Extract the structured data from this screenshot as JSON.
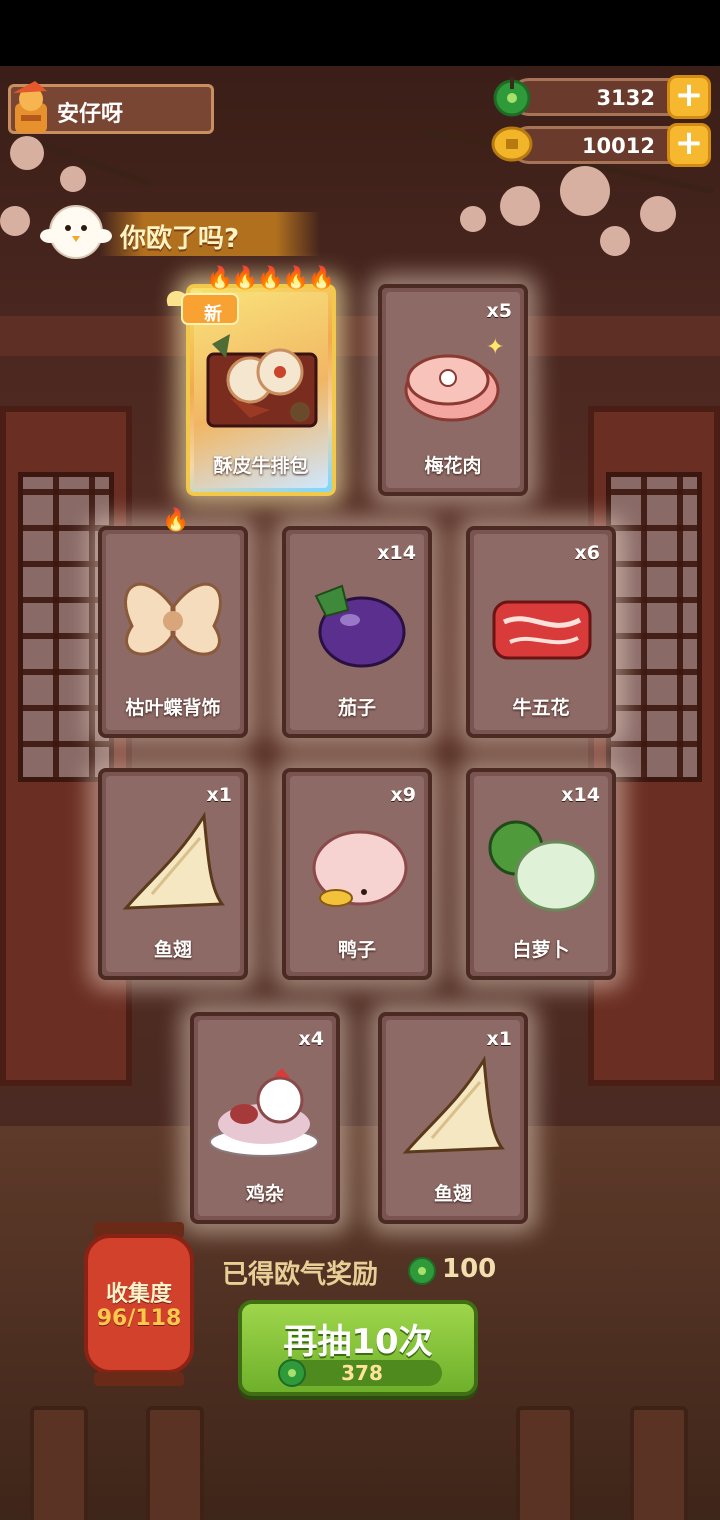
{
  "player": {
    "name": "安仔呀"
  },
  "currencies": [
    {
      "icon": "jade-icon",
      "value": "3132"
    },
    {
      "icon": "coin-icon",
      "value": "10012"
    }
  ],
  "banner": {
    "text": "你欧了吗?"
  },
  "new_tag": "新",
  "cards": [
    {
      "name": "酥皮牛排包",
      "qty": "",
      "rarity": "gold",
      "is_new": true,
      "flames": 5
    },
    {
      "name": "梅花肉",
      "qty": "x5",
      "rarity": "normal"
    },
    {
      "name": "枯叶蝶背饰",
      "qty": "",
      "rarity": "normal",
      "flames": 1
    },
    {
      "name": "茄子",
      "qty": "x14",
      "rarity": "normal"
    },
    {
      "name": "牛五花",
      "qty": "x6",
      "rarity": "normal"
    },
    {
      "name": "鱼翅",
      "qty": "x1",
      "rarity": "normal"
    },
    {
      "name": "鸭子",
      "qty": "x9",
      "rarity": "normal"
    },
    {
      "name": "白萝卜",
      "qty": "x14",
      "rarity": "normal"
    },
    {
      "name": "鸡杂",
      "qty": "x4",
      "rarity": "normal"
    },
    {
      "name": "鱼翅",
      "qty": "x1",
      "rarity": "normal"
    }
  ],
  "collection": {
    "label": "收集度",
    "progress": "96/118"
  },
  "reward": {
    "label": "已得欧气奖励",
    "value": "100"
  },
  "draw_button": {
    "label": "再抽10次",
    "cost": "378"
  },
  "colors": {
    "green_button": "#7fbe35",
    "gold_card": "#f3c24a",
    "card": "#7a5450"
  }
}
